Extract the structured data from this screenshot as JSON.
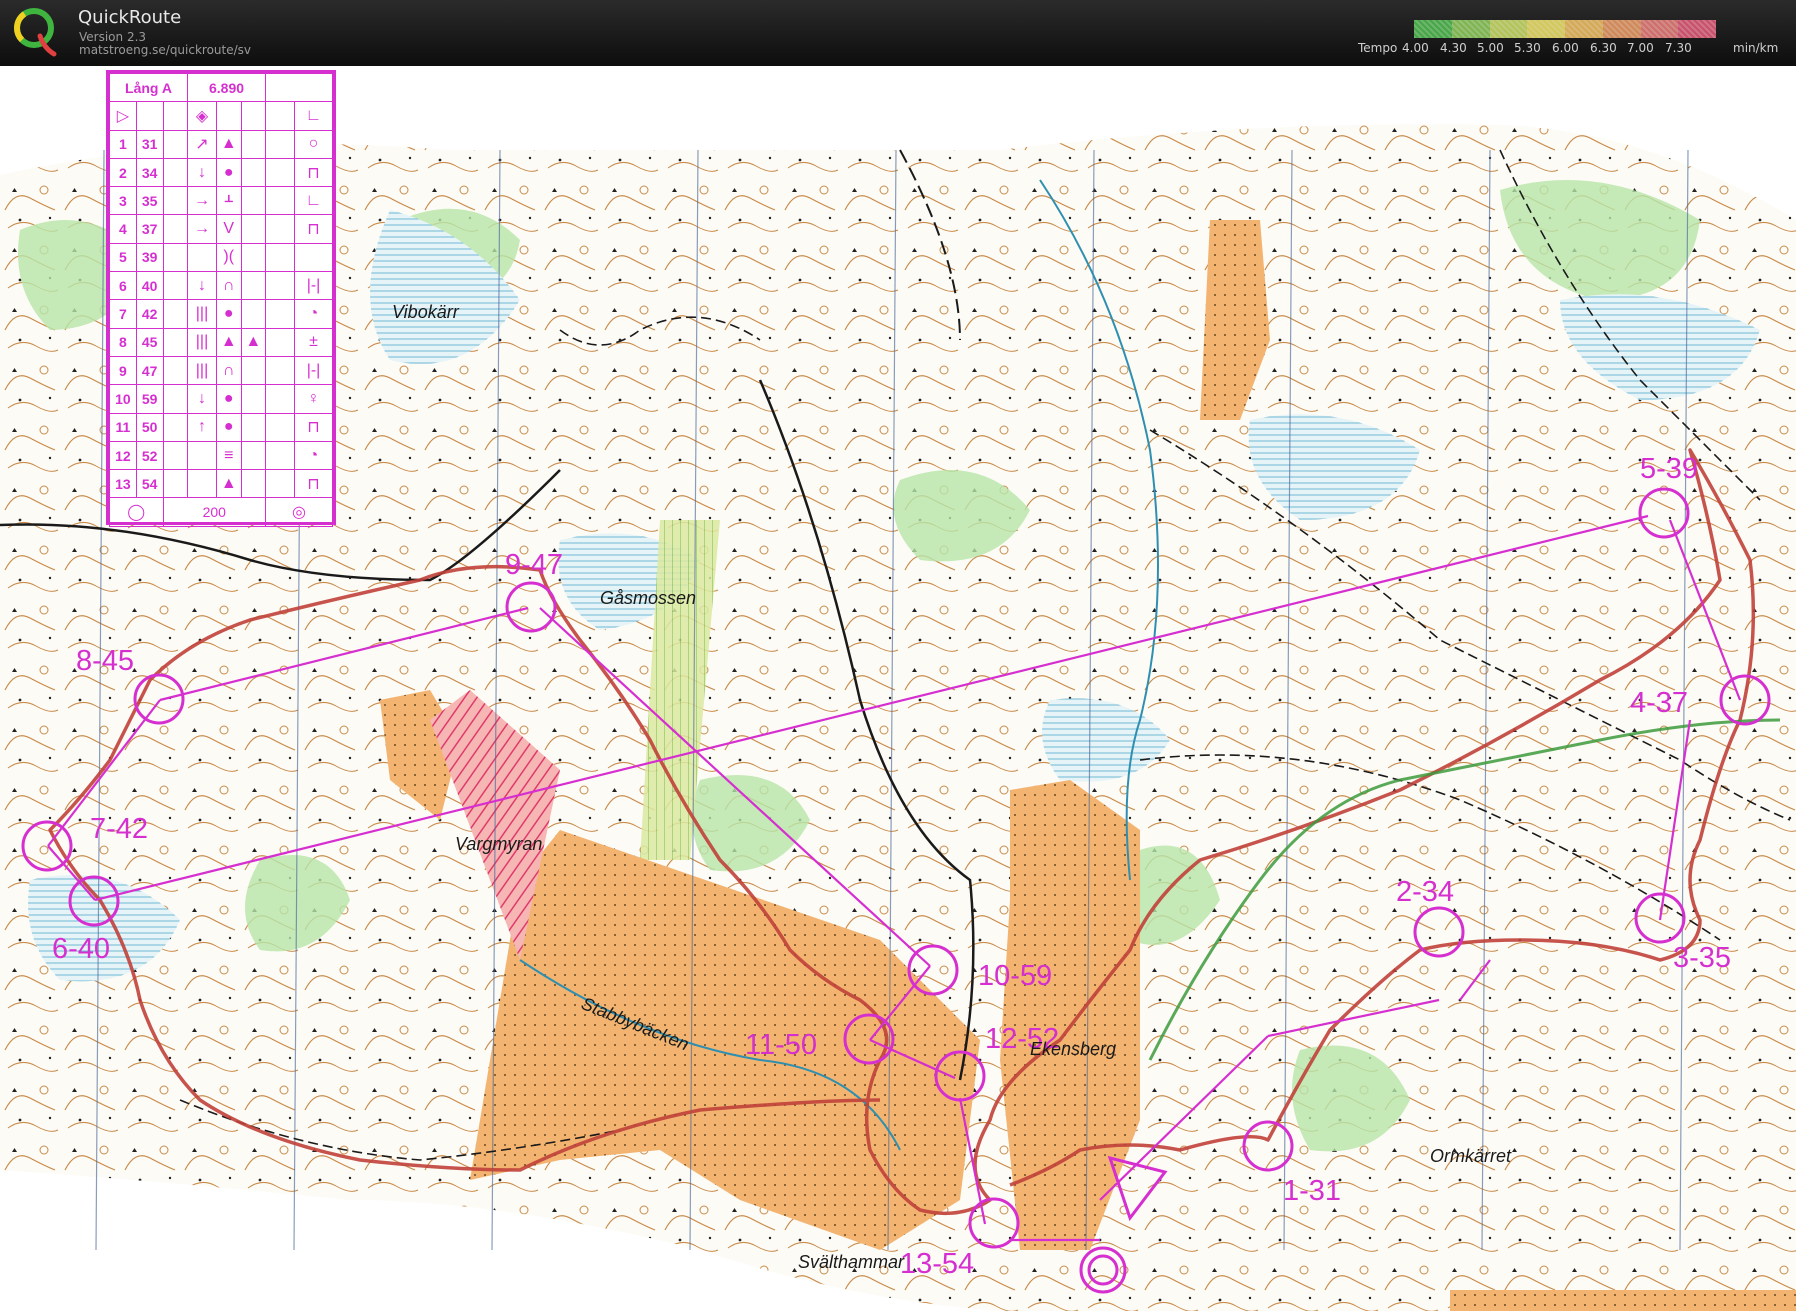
{
  "app": {
    "name": "QuickRoute",
    "version": "Version 2.3",
    "url": "matstroeng.se/quickroute/sv"
  },
  "legend": {
    "label": "Tempo",
    "ticks": [
      "4.00",
      "4.30",
      "5.00",
      "5.30",
      "6.00",
      "6.30",
      "7.00",
      "7.30"
    ],
    "unit": "min/km",
    "colors": [
      "#4fbf4f",
      "#8fd05a",
      "#cde163",
      "#f3e665",
      "#f6c25f",
      "#f19c63",
      "#ee7c78",
      "#e85a7a"
    ]
  },
  "card": {
    "course": "Lång A",
    "length": "6.890",
    "rows": [
      {
        "n": "1",
        "code": "31",
        "d": "↗",
        "f": "▲",
        "g": "○"
      },
      {
        "n": "2",
        "code": "34",
        "d": "↓",
        "f": "●",
        "g": "⊓"
      },
      {
        "n": "3",
        "code": "35",
        "d": "→",
        "f": "ᚆ",
        "g": "∟"
      },
      {
        "n": "4",
        "code": "37",
        "d": "→",
        "f": "V",
        "g": "⊓"
      },
      {
        "n": "5",
        "code": "39",
        "d": "",
        "f": ")(",
        "g": ""
      },
      {
        "n": "6",
        "code": "40",
        "d": "↓",
        "f": "∩",
        "g": "|-|"
      },
      {
        "n": "7",
        "code": "42",
        "d": "|||",
        "f": "●",
        "g": "◔"
      },
      {
        "n": "8",
        "code": "45",
        "d": "|||",
        "f": "▲",
        "e": "▲",
        "g": "±"
      },
      {
        "n": "9",
        "code": "47",
        "d": "|||",
        "f": "∩",
        "g": "|-|"
      },
      {
        "n": "10",
        "code": "59",
        "d": "↓",
        "f": "●",
        "g": "♀"
      },
      {
        "n": "11",
        "code": "50",
        "d": "↑",
        "f": "●",
        "g": "⊓"
      },
      {
        "n": "12",
        "code": "52",
        "d": "",
        "f": "≡",
        "g": "◔"
      },
      {
        "n": "13",
        "code": "54",
        "d": "",
        "f": "▲",
        "g": "⊓"
      }
    ],
    "finish_distance": "200"
  },
  "map": {
    "place_names": {
      "vibokarr": "Vibokärr",
      "gasmossen": "Gåsmossen",
      "vargmyran": "Vargmyran",
      "stabbybacken": "Stabbybäcken",
      "ekensberg": "Ekensberg",
      "ormkarret": "Ormkärret",
      "svalthammar": "Svälthammar"
    },
    "controls": {
      "c1": "1-31",
      "c2": "2-34",
      "c3": "3-35",
      "c4": "4-37",
      "c5": "5-39",
      "c6": "6-40",
      "c7": "7-42",
      "c8": "8-45",
      "c9": "9-47",
      "c10": "10-59",
      "c11": "11-50",
      "c12": "12-52",
      "c13": "13-54"
    },
    "course_color": "#d62fd0"
  }
}
